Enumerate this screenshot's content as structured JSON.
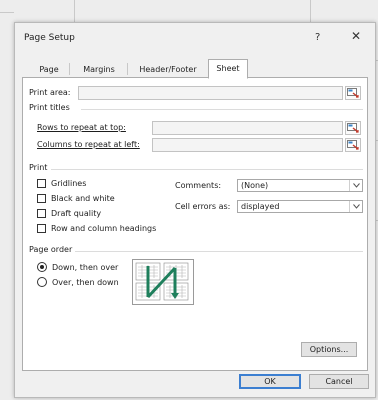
{
  "dialog": {
    "title": "Page Setup",
    "help_glyph": "?",
    "close_glyph": "✕"
  },
  "tabs": [
    {
      "label": "Page",
      "active": false
    },
    {
      "label": "Margins",
      "active": false
    },
    {
      "label": "Header/Footer",
      "active": false
    },
    {
      "label": "Sheet",
      "active": true
    }
  ],
  "sheet": {
    "print_area": {
      "label": "Print area:",
      "value": ""
    },
    "print_titles": {
      "heading": "Print titles",
      "rows": {
        "label": "Rows to repeat at top:",
        "value": ""
      },
      "columns": {
        "label": "Columns to repeat at left:",
        "value": ""
      }
    },
    "print": {
      "heading": "Print",
      "gridlines": {
        "label": "Gridlines",
        "checked": false
      },
      "black_white": {
        "label": "Black and white",
        "checked": false
      },
      "draft_quality": {
        "label": "Draft quality",
        "checked": false
      },
      "row_col_headings": {
        "label": "Row and column headings",
        "checked": false
      },
      "comments": {
        "label": "Comments:",
        "value": "(None)"
      },
      "cell_errors": {
        "label": "Cell errors as:",
        "value": "displayed"
      }
    },
    "page_order": {
      "heading": "Page order",
      "down_then_over": {
        "label": "Down, then over",
        "selected": true
      },
      "over_then_down": {
        "label": "Over, then down",
        "selected": false
      }
    }
  },
  "buttons": {
    "options": "Options...",
    "ok": "OK",
    "cancel": "Cancel"
  },
  "icons": {
    "range_select": "collapse-dialog-icon",
    "dropdown": "chevron-down-icon"
  },
  "colors": {
    "default_button_border": "#3c7fd1",
    "page_order_arrow": "#1f7f5c"
  }
}
